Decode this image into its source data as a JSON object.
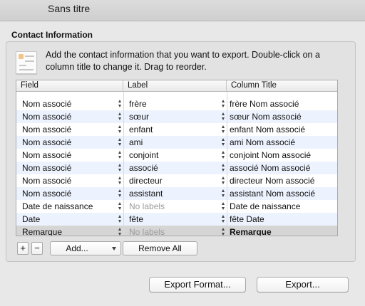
{
  "window": {
    "title": "Sans titre"
  },
  "section": {
    "title": "Contact Information",
    "instruction": "Add the contact information that you want to export. Double-click on a column title to change it. Drag to reorder."
  },
  "table": {
    "columns": [
      "Field",
      "Label",
      "Column Title"
    ],
    "rows": [
      {
        "field": "Nom associé",
        "label": "frère",
        "title": "frère Nom associé",
        "label_dim": false,
        "selected": false
      },
      {
        "field": "Nom associé",
        "label": "sœur",
        "title": "sœur Nom associé",
        "label_dim": false,
        "selected": false
      },
      {
        "field": "Nom associé",
        "label": "enfant",
        "title": "enfant Nom associé",
        "label_dim": false,
        "selected": false
      },
      {
        "field": "Nom associé",
        "label": "ami",
        "title": "ami Nom associé",
        "label_dim": false,
        "selected": false
      },
      {
        "field": "Nom associé",
        "label": "conjoint",
        "title": "conjoint Nom associé",
        "label_dim": false,
        "selected": false
      },
      {
        "field": "Nom associé",
        "label": "associé",
        "title": "associé Nom associé",
        "label_dim": false,
        "selected": false
      },
      {
        "field": "Nom associé",
        "label": "directeur",
        "title": "directeur Nom associé",
        "label_dim": false,
        "selected": false
      },
      {
        "field": "Nom associé",
        "label": "assistant",
        "title": "assistant Nom associé",
        "label_dim": false,
        "selected": false
      },
      {
        "field": "Date de naissance",
        "label": "No labels",
        "title": "Date de naissance",
        "label_dim": true,
        "selected": false
      },
      {
        "field": "Date",
        "label": "fête",
        "title": "fête Date",
        "label_dim": false,
        "selected": false
      },
      {
        "field": "Remarque",
        "label": "No labels",
        "title": "Remarque",
        "label_dim": true,
        "selected": true
      }
    ]
  },
  "controls": {
    "plus": "+",
    "minus": "−",
    "add": "Add...",
    "remove_all": "Remove All"
  },
  "footer": {
    "export_format": "Export Format...",
    "export": "Export..."
  }
}
